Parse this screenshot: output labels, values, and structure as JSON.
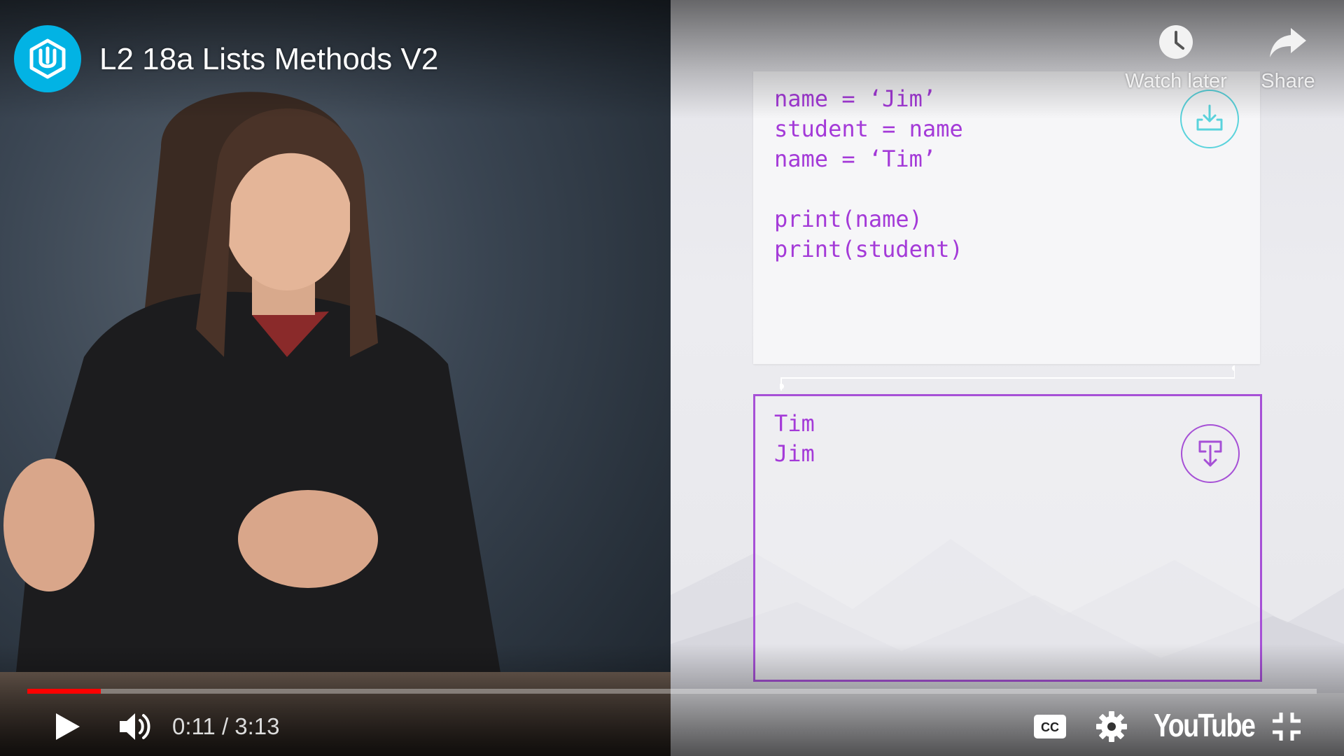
{
  "header": {
    "title": "L2 18a Lists Methods V2",
    "watch_later_label": "Watch later",
    "share_label": "Share"
  },
  "slide": {
    "code_lines": [
      "name = ‘Jim’",
      "student = name",
      "name = ‘Tim’",
      "",
      "print(name)",
      "print(student)"
    ],
    "output_lines": [
      "Tim",
      "Jim"
    ]
  },
  "controls": {
    "time": "0:11 / 3:13",
    "progress_fraction": 0.057,
    "brand": "YouTube"
  },
  "colors": {
    "channel_logo": "#02b3e4",
    "code_text": "#a43ad8",
    "output_border": "#a650d6",
    "progress": "#ff0000"
  },
  "icons": {
    "channel": "udacity-logo-icon",
    "watch_later": "clock-icon",
    "share": "share-arrow-icon",
    "code_panel": "download-tray-icon",
    "output_panel": "output-arrow-icon",
    "play": "play-icon",
    "volume": "volume-icon",
    "captions": "cc-icon",
    "settings": "gear-icon",
    "fullscreen": "exit-fullscreen-icon"
  }
}
